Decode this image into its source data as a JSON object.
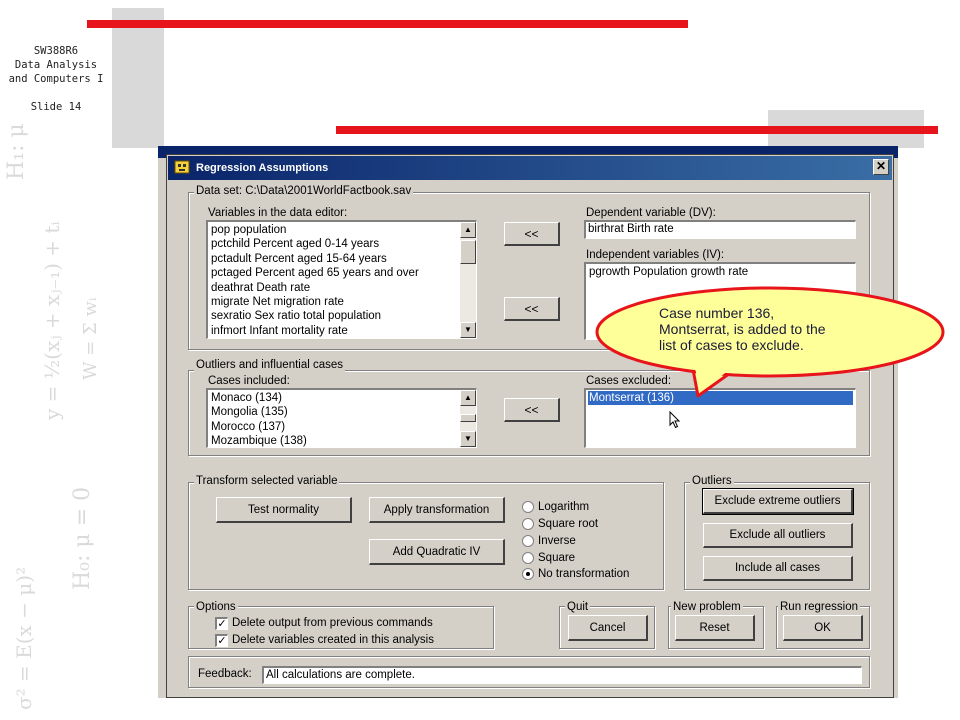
{
  "slide": {
    "course_line1": "SW388R6",
    "course_line2": "Data Analysis",
    "course_line3": "and Computers I",
    "slide_label": "Slide 14",
    "accent_color": "#e8141b"
  },
  "dialog": {
    "title": "Regression Assumptions",
    "close_symbol": "✕",
    "dataset_legend": "Data set: C:\\Data\\2001WorldFactbook.sav",
    "variables_label": "Variables in the data editor:",
    "variables": [
      "pop    population",
      "pctchild    Percent aged 0-14 years",
      "pctadult    Percent aged 15-64 years",
      "pctaged    Percent aged 65 years and over",
      "deathrat    Death rate",
      "migrate    Net migration rate",
      "sexratio    Sex ratio total population",
      "infmort    Infant mortality rate"
    ],
    "move_dv_button": "<<",
    "move_iv_button": "<<",
    "dv_label": "Dependent variable (DV):",
    "dv_value": "birthrat    Birth rate",
    "iv_label": "Independent variables (IV):",
    "iv_values": [
      "pgrowth    Population growth rate"
    ],
    "outliers_legend": "Outliers and influential cases",
    "cases_included_label": "Cases included:",
    "cases_included": [
      "Monaco (134)",
      "Mongolia (135)",
      "Morocco (137)",
      "Mozambique (138)"
    ],
    "move_case_button": "<<",
    "cases_excluded_label": "Cases excluded:",
    "cases_excluded": [
      "Montserrat (136)"
    ],
    "transform_legend": "Transform selected variable",
    "test_normality_button": "Test normality",
    "apply_transformation_button": "Apply transformation",
    "add_quadratic_button": "Add Quadratic IV",
    "transform_options": [
      "Logarithm",
      "Square root",
      "Inverse",
      "Square",
      "No transformation"
    ],
    "transform_selected": "No transformation",
    "outliers_group_legend": "Outliers",
    "exclude_extreme_button": "Exclude extreme outliers",
    "exclude_all_button": "Exclude all outliers",
    "include_all_button": "Include all cases",
    "options_legend": "Options",
    "option_delete_output": "Delete output from previous commands",
    "option_delete_variables": "Delete variables created in this analysis",
    "option_delete_output_checked": true,
    "option_delete_variables_checked": true,
    "check_mark": "✓",
    "quit_legend": "Quit",
    "cancel_button": "Cancel",
    "new_problem_legend": "New problem",
    "reset_button": "Reset",
    "run_regression_legend": "Run regression",
    "ok_button": "OK",
    "feedback_label": "Feedback:",
    "feedback_value": "All calculations are complete.",
    "title_bar_color": "#0a246a",
    "selection_color": "#316ac5"
  },
  "callout": {
    "line1": "Case number 136,",
    "line2": "Montserrat, is added to the",
    "line3": "list of cases to exclude.",
    "fill_color": "#ffff99",
    "border_color": "#e8141b"
  },
  "decor": {
    "formula_1": "H₁: μ < 0",
    "formula_2": "y = ½(xⱼ + xⱼ₋₁) + tᵢ",
    "formula_3": "H₀: μ = 0",
    "formula_4": "σ² = E(x − μ)²",
    "formula_5": "W = Σ wᵢ"
  }
}
